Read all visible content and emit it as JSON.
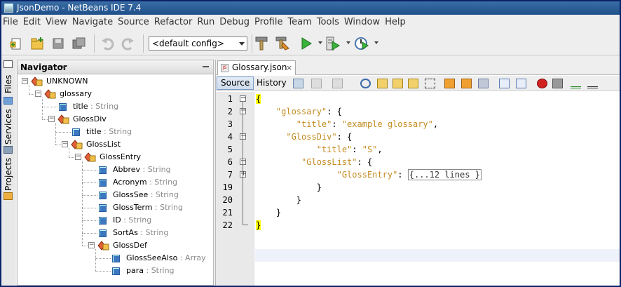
{
  "window": {
    "title": "JsonDemo - NetBeans IDE 7.4"
  },
  "menu": [
    "File",
    "Edit",
    "View",
    "Navigate",
    "Source",
    "Refactor",
    "Run",
    "Debug",
    "Profile",
    "Team",
    "Tools",
    "Window",
    "Help"
  ],
  "toolbar": {
    "config_value": "<default config>",
    "icons": [
      "new-file-icon",
      "new-project-icon",
      "open-project-icon",
      "save-all-icon",
      "undo-icon",
      "redo-icon",
      "build-icon",
      "clean-build-icon",
      "run-icon",
      "debug-icon",
      "profile-icon"
    ]
  },
  "side_tabs": [
    "Files",
    "Services",
    "Projects"
  ],
  "navigator": {
    "title": "Navigator",
    "close": "×",
    "tree": [
      {
        "label": "UNKNOWN",
        "type": "",
        "depth": 0,
        "kind": "object",
        "toggle": "−"
      },
      {
        "label": "glossary",
        "type": "",
        "depth": 1,
        "kind": "object",
        "toggle": "−"
      },
      {
        "label": "title",
        "type": " : String",
        "depth": 2,
        "kind": "value",
        "toggle": ""
      },
      {
        "label": "GlossDiv",
        "type": "",
        "depth": 2,
        "kind": "object",
        "toggle": "−"
      },
      {
        "label": "title",
        "type": " : String",
        "depth": 3,
        "kind": "value",
        "toggle": ""
      },
      {
        "label": "GlossList",
        "type": "",
        "depth": 3,
        "kind": "object",
        "toggle": "−"
      },
      {
        "label": "GlossEntry",
        "type": "",
        "depth": 4,
        "kind": "object",
        "toggle": "−"
      },
      {
        "label": "Abbrev",
        "type": " : String",
        "depth": 5,
        "kind": "value",
        "toggle": ""
      },
      {
        "label": "Acronym",
        "type": " : String",
        "depth": 5,
        "kind": "value",
        "toggle": ""
      },
      {
        "label": "GlossSee",
        "type": " : String",
        "depth": 5,
        "kind": "value",
        "toggle": ""
      },
      {
        "label": "GlossTerm",
        "type": " : String",
        "depth": 5,
        "kind": "value",
        "toggle": ""
      },
      {
        "label": "ID",
        "type": " : String",
        "depth": 5,
        "kind": "value",
        "toggle": ""
      },
      {
        "label": "SortAs",
        "type": " : String",
        "depth": 5,
        "kind": "value",
        "toggle": ""
      },
      {
        "label": "GlossDef",
        "type": "",
        "depth": 5,
        "kind": "object",
        "toggle": "−"
      },
      {
        "label": "GlossSeeAlso",
        "type": " : Array",
        "depth": 6,
        "kind": "value",
        "toggle": ""
      },
      {
        "label": "para",
        "type": " : String",
        "depth": 6,
        "kind": "value",
        "toggle": ""
      }
    ]
  },
  "editor": {
    "tab_label": "Glossary.json",
    "tab_close": "×",
    "file_badge": "JS",
    "source_label": "Source",
    "history_label": "History",
    "lines": [
      {
        "num": "1",
        "fold": "−",
        "parts": [
          {
            "t": "{",
            "c": "hl"
          }
        ]
      },
      {
        "num": "2",
        "fold": "−",
        "parts": [
          {
            "t": "    ",
            "c": ""
          },
          {
            "t": "\"glossary\"",
            "c": "k"
          },
          {
            "t": ": {",
            "c": ""
          }
        ]
      },
      {
        "num": "3",
        "fold": "",
        "parts": [
          {
            "t": "        ",
            "c": ""
          },
          {
            "t": "\"title\"",
            "c": "k"
          },
          {
            "t": ": ",
            "c": ""
          },
          {
            "t": "\"example glossary\"",
            "c": "s"
          },
          {
            "t": ",",
            "c": ""
          }
        ]
      },
      {
        "num": "4",
        "fold": "−",
        "parts": [
          {
            "t": "      ",
            "c": ""
          },
          {
            "t": "\"GlossDiv\"",
            "c": "k"
          },
          {
            "t": ": {",
            "c": ""
          }
        ]
      },
      {
        "num": "5",
        "fold": "",
        "parts": [
          {
            "t": "            ",
            "c": ""
          },
          {
            "t": "\"title\"",
            "c": "k"
          },
          {
            "t": ": ",
            "c": ""
          },
          {
            "t": "\"S\"",
            "c": "s"
          },
          {
            "t": ",",
            "c": ""
          }
        ]
      },
      {
        "num": "6",
        "fold": "−",
        "parts": [
          {
            "t": "         ",
            "c": ""
          },
          {
            "t": "\"GlossList\"",
            "c": "k"
          },
          {
            "t": ": {",
            "c": ""
          }
        ]
      },
      {
        "num": "7",
        "fold": "+",
        "parts": [
          {
            "t": "                ",
            "c": ""
          },
          {
            "t": "\"GlossEntry\"",
            "c": "k"
          },
          {
            "t": ": ",
            "c": ""
          },
          {
            "t": "{...12 lines }",
            "c": "collapsed"
          }
        ]
      },
      {
        "num": "19",
        "fold": "",
        "parts": [
          {
            "t": "            }",
            "c": ""
          }
        ]
      },
      {
        "num": "20",
        "fold": "",
        "parts": [
          {
            "t": "        }",
            "c": ""
          }
        ]
      },
      {
        "num": "21",
        "fold": "",
        "parts": [
          {
            "t": "    }",
            "c": ""
          }
        ]
      },
      {
        "num": "22",
        "fold": "end",
        "parts": [
          {
            "t": "}",
            "c": "hl"
          }
        ]
      }
    ]
  }
}
